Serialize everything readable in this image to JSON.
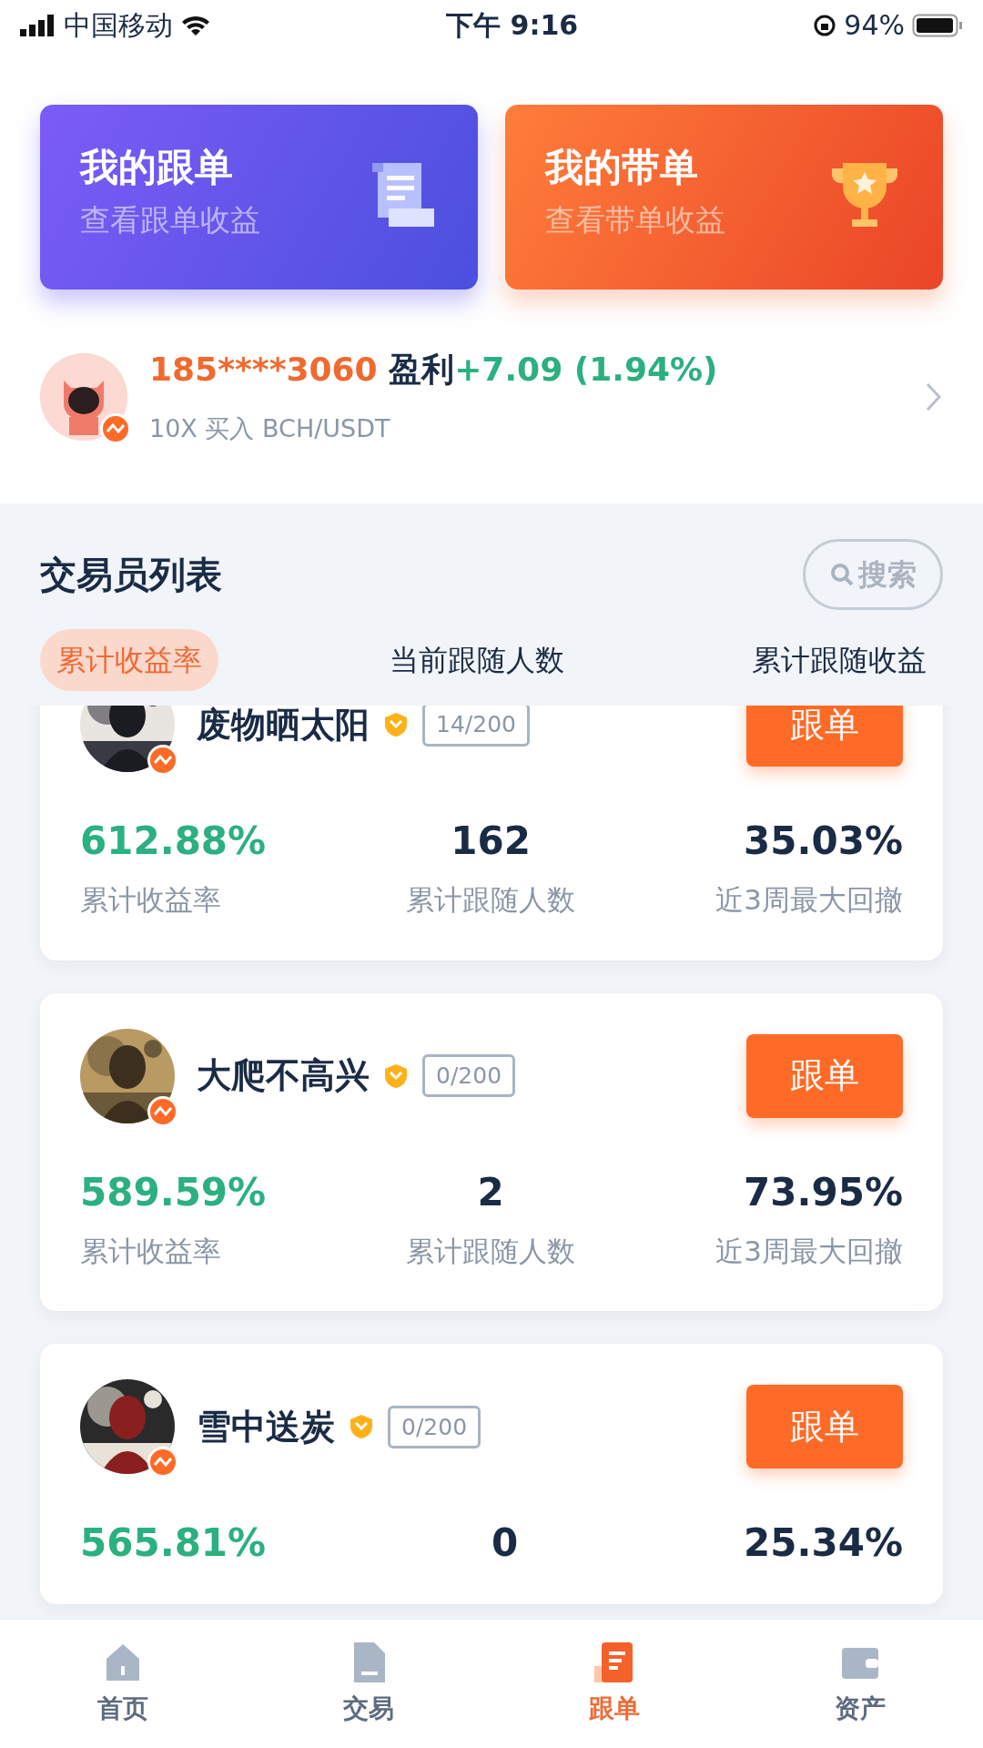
{
  "status_bar": {
    "carrier": "中国移动",
    "time": "下午 9:16",
    "battery": "94%"
  },
  "hero_cards": [
    {
      "kind": "follow",
      "title": "我的跟单",
      "subtitle": "查看跟单收益"
    },
    {
      "kind": "lead",
      "title": "我的带单",
      "subtitle": "查看带单收益"
    }
  ],
  "ticker": {
    "user": "185****3060",
    "profit_label": "盈利",
    "profit": "+7.09 (1.94%)",
    "detail": "10X 买入 BCH/USDT"
  },
  "section": {
    "title": "交易员列表",
    "search_button": "搜索"
  },
  "sort_tabs": [
    {
      "label": "累计收益率",
      "selected": true
    },
    {
      "label": "当前跟随人数",
      "selected": false
    },
    {
      "label": "累计跟随收益",
      "selected": false
    }
  ],
  "traders": [
    {
      "name": "废物晒太阳",
      "slots": "14/200",
      "button": "跟单",
      "stats": [
        {
          "value": "612.88%",
          "label": "累计收益率"
        },
        {
          "value": "162",
          "label": "累计跟随人数"
        },
        {
          "value": "35.03%",
          "label": "近3周最大回撤"
        }
      ]
    },
    {
      "name": "大爬不高兴",
      "slots": "0/200",
      "button": "跟单",
      "stats": [
        {
          "value": "589.59%",
          "label": "累计收益率"
        },
        {
          "value": "2",
          "label": "累计跟随人数"
        },
        {
          "value": "73.95%",
          "label": "近3周最大回撤"
        }
      ]
    },
    {
      "name": "雪中送炭",
      "slots": "0/200",
      "button": "跟单",
      "stats": [
        {
          "value": "565.81%"
        },
        {
          "value": "0"
        },
        {
          "value": "25.34%"
        }
      ]
    }
  ],
  "bottom_nav": [
    {
      "kind": "home",
      "label": "首页",
      "selected": false
    },
    {
      "kind": "trade",
      "label": "交易",
      "selected": false
    },
    {
      "kind": "copy",
      "label": "跟单",
      "selected": true
    },
    {
      "kind": "assets",
      "label": "资产",
      "selected": false
    }
  ]
}
